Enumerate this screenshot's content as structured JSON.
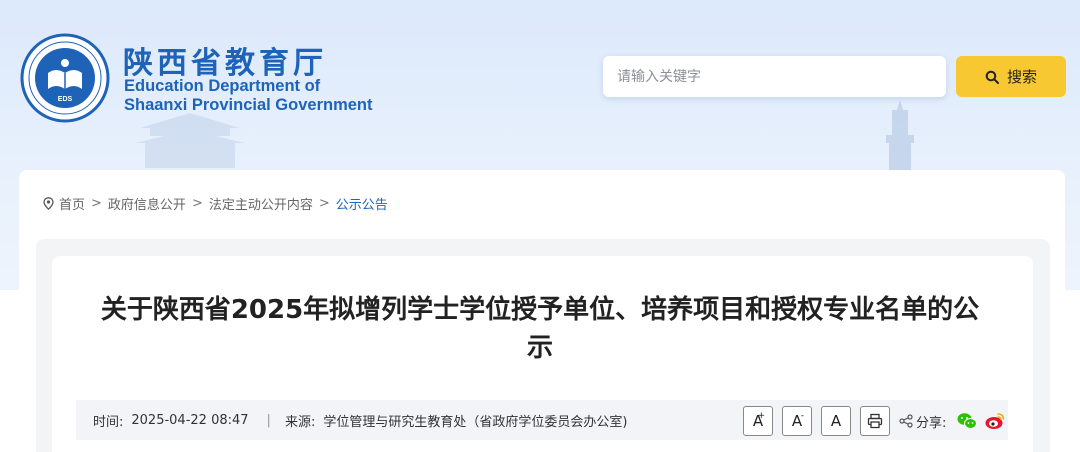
{
  "header": {
    "logo_text": "EDUCATION DEPARTMENT OF SHAANXI · 陕西省教育厅",
    "logo_badge": "EDS",
    "brand_cn": "陕西省教育厅",
    "brand_en_line1": "Education Department of",
    "brand_en_line2": "Shaanxi Provincial Government"
  },
  "search": {
    "placeholder": "请输入关键字",
    "button_label": "搜索"
  },
  "breadcrumb": {
    "items": [
      "首页",
      "政府信息公开",
      "法定主动公开内容"
    ],
    "separator": ">",
    "current": "公示公告"
  },
  "article": {
    "title": "关于陕西省2025年拟增列学士学位授予单位、培养项目和授权专业名单的公示",
    "time_label": "时间:",
    "time_value": "2025-04-22 08:47",
    "divider": "|",
    "source_label": "来源:",
    "source_value": "学位管理与研究生教育处（省政府学位委员会办公室)"
  },
  "tools": {
    "font_large": "A",
    "font_large_sup": "+",
    "font_small": "A",
    "font_small_sup": "-",
    "font_default": "A",
    "share_label": "分享:"
  },
  "colors": {
    "brand_blue": "#1f63b8",
    "search_yellow": "#f8c832",
    "wechat_green": "#2dc100",
    "weibo_red": "#e6162d"
  }
}
